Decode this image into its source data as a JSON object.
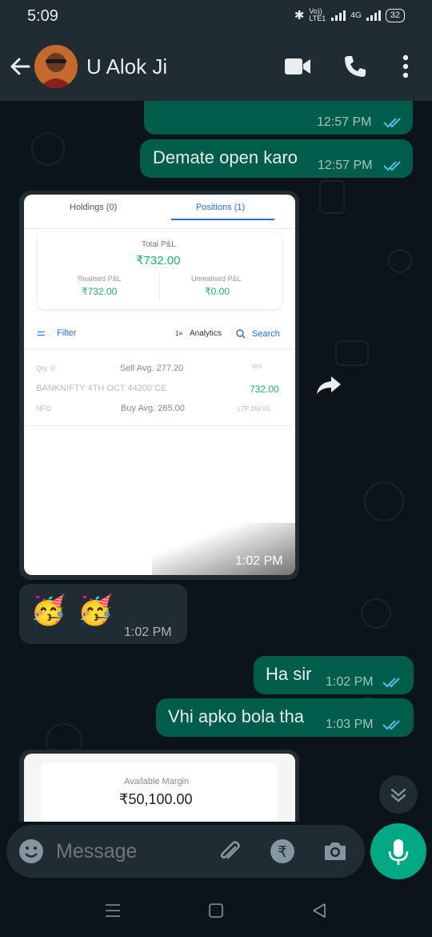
{
  "status": {
    "time": "5:09",
    "volte": "Vo)) LTE1",
    "network": "4G",
    "battery": "32"
  },
  "header": {
    "contact_name": "U Alok Ji"
  },
  "messages": [
    {
      "type": "out",
      "text": "",
      "time": "12:57 PM"
    },
    {
      "type": "out",
      "text": "Demate open karo",
      "time": "12:57 PM"
    },
    {
      "type": "in-image",
      "time": "1:02 PM"
    },
    {
      "type": "in",
      "text": "🥳 🥳",
      "time": "1:02 PM"
    },
    {
      "type": "out",
      "text": "Ha sir",
      "time": "1:02 PM"
    },
    {
      "type": "out",
      "text": "Vhi apko bola tha",
      "time": "1:03 PM"
    }
  ],
  "screenshot1": {
    "tab_holdings": "Holdings (0)",
    "tab_positions": "Positions (1)",
    "total_pl_label": "Total P&L",
    "total_pl_value": "₹732.00",
    "realised_label": "Realised P&L",
    "realised_value": "₹732.00",
    "unrealised_label": "Unrealised P&L",
    "unrealised_value": "₹0.00",
    "filter": "Filter",
    "analytics": "Analytics",
    "search": "Search",
    "qty": "Qty. 0",
    "sell_avg": "Sell Avg. 277.20",
    "mis": "MIS",
    "instrument": "BANKNIFTY 4TH OCT 44200 CE",
    "pnl": "732.00",
    "exchange": "NFO",
    "buy_avg": "Buy Avg. 265.00",
    "ltp": "LTP  260.65"
  },
  "screenshot2": {
    "available_margin_label": "Available Margin",
    "available_margin_value": "₹50,100.00"
  },
  "input": {
    "placeholder": "Message"
  },
  "colors": {
    "outgoing": "#005c4b",
    "incoming": "#1f2c34",
    "accent": "#00a884",
    "tick": "#53bdeb"
  }
}
